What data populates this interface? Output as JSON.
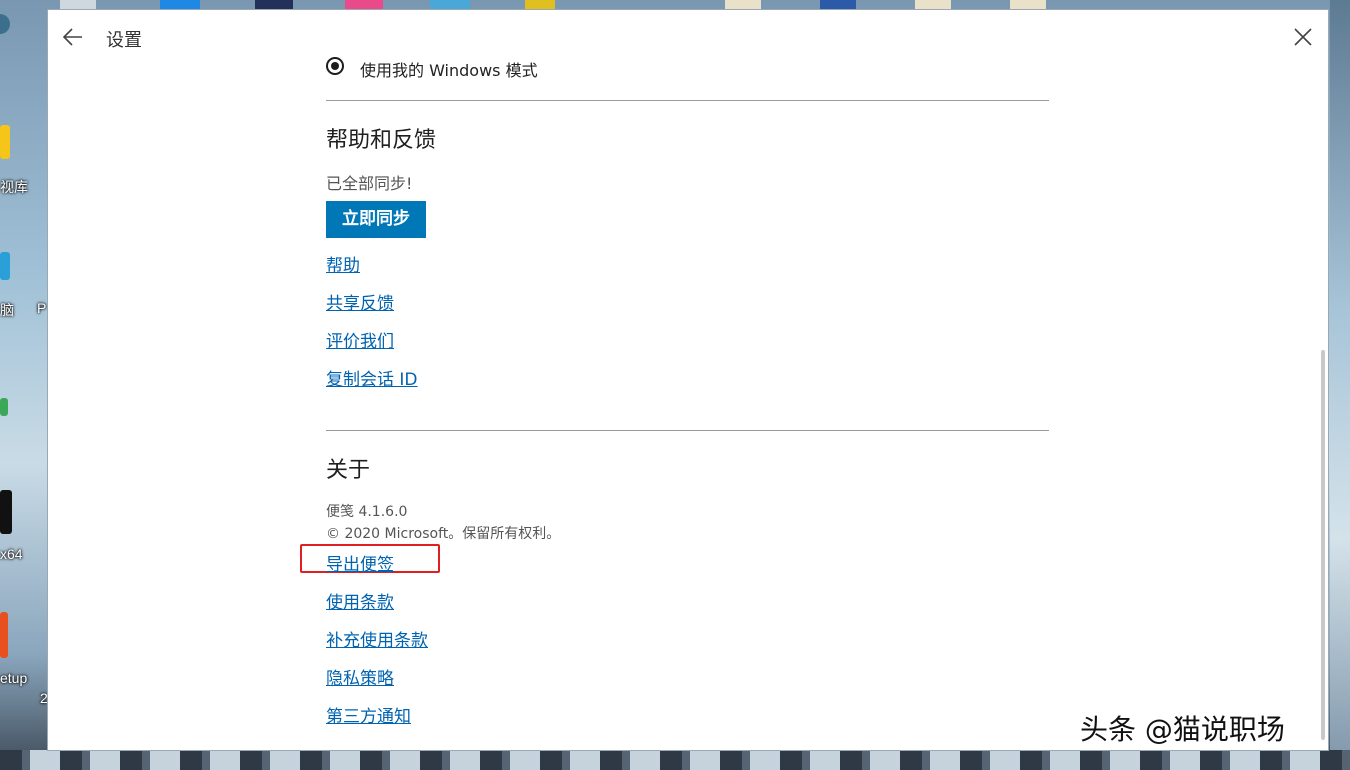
{
  "desktop": {
    "labels": [
      "视库",
      "脑",
      "P",
      "x64",
      "etup",
      "2"
    ]
  },
  "window": {
    "title": "设置",
    "theme_option": "使用我的 Windows 模式",
    "help_section": {
      "title": "帮助和反馈",
      "sync_status": "已全部同步!",
      "sync_button": "立即同步",
      "links": [
        "帮助",
        "共享反馈",
        "评价我们",
        "复制会话 ID"
      ]
    },
    "about_section": {
      "title": "关于",
      "version": "便笺 4.1.6.0",
      "copyright": "© 2020 Microsoft。保留所有权利。",
      "links": [
        "导出便签",
        "使用条款",
        "补充使用条款",
        "隐私策略",
        "第三方通知"
      ]
    }
  },
  "watermark": "头条 @猫说职场",
  "colors": {
    "accent": "#0078b8",
    "link": "#0063b1",
    "highlight": "#e02020"
  },
  "icons": [
    "back-arrow-icon",
    "close-icon",
    "radio-selected-icon"
  ]
}
